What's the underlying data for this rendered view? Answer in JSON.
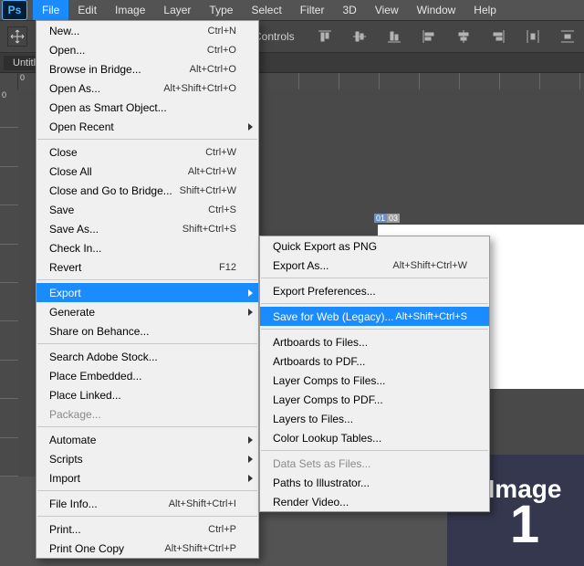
{
  "app": {
    "badge": "Ps"
  },
  "menubar": [
    "File",
    "Edit",
    "Image",
    "Layer",
    "Type",
    "Select",
    "Filter",
    "3D",
    "View",
    "Window",
    "Help"
  ],
  "menubar_open_index": 0,
  "options_bar": {
    "controls_label": "Controls"
  },
  "doc_tab": {
    "label": "Untitl"
  },
  "h_ruler_ticks": [
    "0",
    "",
    "",
    "",
    "",
    "",
    "",
    "",
    "",
    "",
    "",
    "",
    "",
    ""
  ],
  "v_ruler_ticks": [
    "0",
    "",
    "",
    "",
    "",
    "",
    "",
    "",
    "",
    ""
  ],
  "slice_badges": [
    "01",
    "03"
  ],
  "image_block": {
    "line1": "Image",
    "line2": "1"
  },
  "file_menu": [
    {
      "type": "item",
      "label": "New...",
      "shortcut": "Ctrl+N"
    },
    {
      "type": "item",
      "label": "Open...",
      "shortcut": "Ctrl+O"
    },
    {
      "type": "item",
      "label": "Browse in Bridge...",
      "shortcut": "Alt+Ctrl+O"
    },
    {
      "type": "item",
      "label": "Open As...",
      "shortcut": "Alt+Shift+Ctrl+O"
    },
    {
      "type": "item",
      "label": "Open as Smart Object..."
    },
    {
      "type": "submenu",
      "label": "Open Recent"
    },
    {
      "type": "sep"
    },
    {
      "type": "item",
      "label": "Close",
      "shortcut": "Ctrl+W"
    },
    {
      "type": "item",
      "label": "Close All",
      "shortcut": "Alt+Ctrl+W"
    },
    {
      "type": "item",
      "label": "Close and Go to Bridge...",
      "shortcut": "Shift+Ctrl+W"
    },
    {
      "type": "item",
      "label": "Save",
      "shortcut": "Ctrl+S"
    },
    {
      "type": "item",
      "label": "Save As...",
      "shortcut": "Shift+Ctrl+S"
    },
    {
      "type": "item",
      "label": "Check In..."
    },
    {
      "type": "item",
      "label": "Revert",
      "shortcut": "F12"
    },
    {
      "type": "sep"
    },
    {
      "type": "submenu",
      "label": "Export",
      "highlight": true
    },
    {
      "type": "submenu",
      "label": "Generate"
    },
    {
      "type": "item",
      "label": "Share on Behance..."
    },
    {
      "type": "sep"
    },
    {
      "type": "item",
      "label": "Search Adobe Stock..."
    },
    {
      "type": "item",
      "label": "Place Embedded..."
    },
    {
      "type": "item",
      "label": "Place Linked..."
    },
    {
      "type": "item",
      "label": "Package...",
      "disabled": true
    },
    {
      "type": "sep"
    },
    {
      "type": "submenu",
      "label": "Automate"
    },
    {
      "type": "submenu",
      "label": "Scripts"
    },
    {
      "type": "submenu",
      "label": "Import"
    },
    {
      "type": "sep"
    },
    {
      "type": "item",
      "label": "File Info...",
      "shortcut": "Alt+Shift+Ctrl+I"
    },
    {
      "type": "sep"
    },
    {
      "type": "item",
      "label": "Print...",
      "shortcut": "Ctrl+P"
    },
    {
      "type": "item",
      "label": "Print One Copy",
      "shortcut": "Alt+Shift+Ctrl+P"
    }
  ],
  "export_menu": [
    {
      "type": "item",
      "label": "Quick Export as PNG"
    },
    {
      "type": "item",
      "label": "Export As...",
      "shortcut": "Alt+Shift+Ctrl+W"
    },
    {
      "type": "sep"
    },
    {
      "type": "item",
      "label": "Export Preferences..."
    },
    {
      "type": "sep"
    },
    {
      "type": "item",
      "label": "Save for Web (Legacy)...",
      "shortcut": "Alt+Shift+Ctrl+S",
      "highlight": true
    },
    {
      "type": "sep"
    },
    {
      "type": "item",
      "label": "Artboards to Files..."
    },
    {
      "type": "item",
      "label": "Artboards to PDF..."
    },
    {
      "type": "item",
      "label": "Layer Comps to Files..."
    },
    {
      "type": "item",
      "label": "Layer Comps to PDF..."
    },
    {
      "type": "item",
      "label": "Layers to Files..."
    },
    {
      "type": "item",
      "label": "Color Lookup Tables..."
    },
    {
      "type": "sep"
    },
    {
      "type": "item",
      "label": "Data Sets as Files...",
      "disabled": true
    },
    {
      "type": "item",
      "label": "Paths to Illustrator..."
    },
    {
      "type": "item",
      "label": "Render Video..."
    }
  ]
}
